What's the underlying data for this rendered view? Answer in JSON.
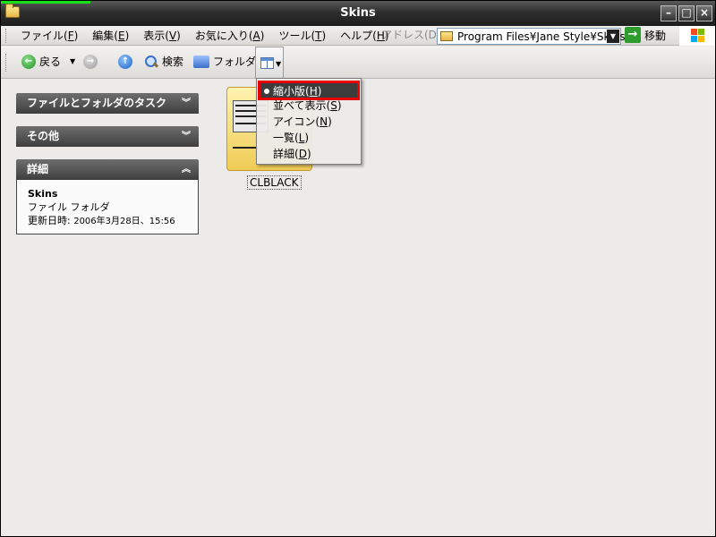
{
  "window": {
    "title": "Skins"
  },
  "menubar": {
    "items": [
      {
        "label": "ファイル(",
        "key": "F",
        "tail": ")"
      },
      {
        "label": "編集(",
        "key": "E",
        "tail": ")"
      },
      {
        "label": "表示(",
        "key": "V",
        "tail": ")"
      },
      {
        "label": "お気に入り(",
        "key": "A",
        "tail": ")"
      },
      {
        "label": "ツール(",
        "key": "T",
        "tail": ")"
      },
      {
        "label": "ヘルプ(",
        "key": "H",
        "tail": ")"
      }
    ],
    "address_label": "アドレス(D)",
    "address_value": "Program Files¥Jane Style¥Skins",
    "go_label": "移動"
  },
  "toolbar": {
    "back_label": "戻る",
    "search_label": "検索",
    "folders_label": "フォルダ"
  },
  "tasks": {
    "file_folder_tasks": "ファイルとフォルダのタスク",
    "other": "その他",
    "details": "詳細",
    "detail_name": "Skins",
    "detail_type": "ファイル フォルダ",
    "detail_modified_label": "更新日時: ",
    "detail_modified_value": "2006年3月28日、15:56"
  },
  "files": [
    {
      "name": "CLBLACK"
    }
  ],
  "views_menu": {
    "selected": "thumbnails",
    "items": [
      {
        "label": "縮小版(",
        "key": "H",
        "tail": ")"
      },
      {
        "label": "並べて表示(",
        "key": "S",
        "tail": ")"
      },
      {
        "label": "アイコン(",
        "key": "N",
        "tail": ")"
      },
      {
        "label": "一覧(",
        "key": "L",
        "tail": ")"
      },
      {
        "label": "詳細(",
        "key": "D",
        "tail": ")"
      }
    ]
  },
  "colors": {
    "highlight_border": "#e60000",
    "titlebar": "#2e2e2e"
  }
}
